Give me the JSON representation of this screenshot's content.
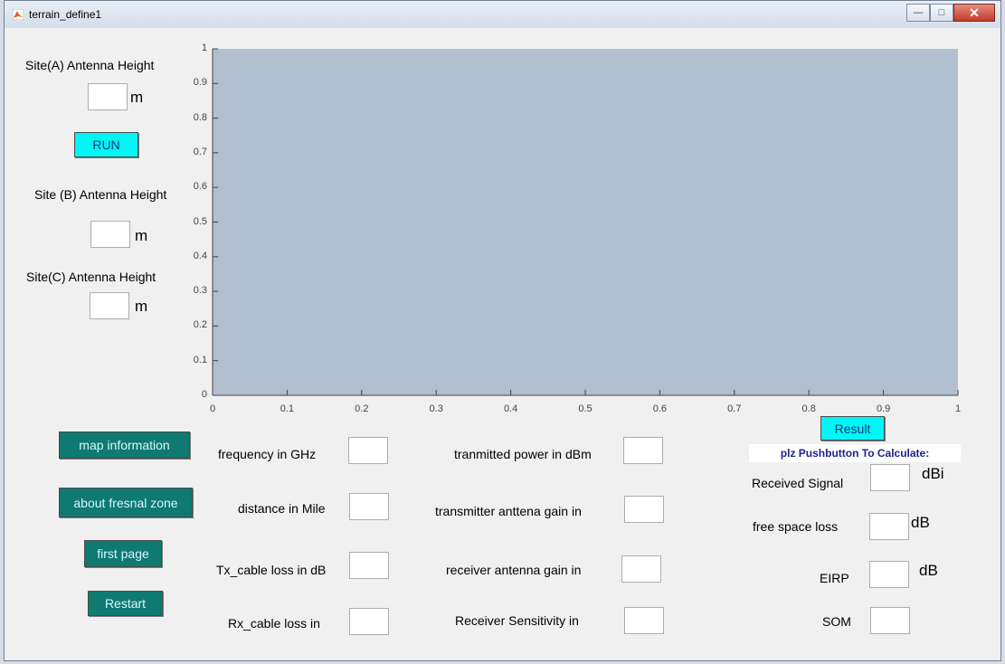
{
  "window": {
    "title": "terrain_define1"
  },
  "left_panel": {
    "site_a_label": "Site(A) Antenna Height",
    "site_b_label": "Site (B) Antenna Height",
    "site_c_label": "Site(C) Antenna Height",
    "unit_m": "m",
    "run_label": "RUN"
  },
  "axes": {
    "y_ticks": [
      "1",
      "0.9",
      "0.8",
      "0.7",
      "0.6",
      "0.5",
      "0.4",
      "0.3",
      "0.2",
      "0.1",
      "0"
    ],
    "x_ticks": [
      "0",
      "0.1",
      "0.2",
      "0.3",
      "0.4",
      "0.5",
      "0.6",
      "0.7",
      "0.8",
      "0.9",
      "1"
    ],
    "bg_color": "#b1bfcf"
  },
  "buttons": {
    "map_information": "map information",
    "about_fresnal_zone": "about fresnal zone",
    "first_page": "first page",
    "restart": "Restart",
    "result": "Result"
  },
  "params_col1": {
    "frequency": "frequency in GHz",
    "distance": "distance in Mile",
    "tx_cable_loss": "Tx_cable loss in dB",
    "rx_cable_loss": "Rx_cable loss in"
  },
  "params_col2": {
    "tx_power": "tranmitted power in dBm",
    "tx_gain": "transmitter anttena gain in",
    "rx_gain": "receiver antenna gain in",
    "rx_sensitivity": "Receiver Sensitivity in"
  },
  "results": {
    "notice": "plz Pushbutton To Calculate:",
    "received_signal": "Received Signal",
    "received_signal_unit": "dBi",
    "free_space_loss": "free space loss",
    "free_space_loss_unit": "dB",
    "eirp": "EIRP",
    "eirp_unit": "dB",
    "som": "SOM"
  },
  "colors": {
    "cyan_button": "#00f5f5",
    "teal_button": "#0f7a72"
  }
}
